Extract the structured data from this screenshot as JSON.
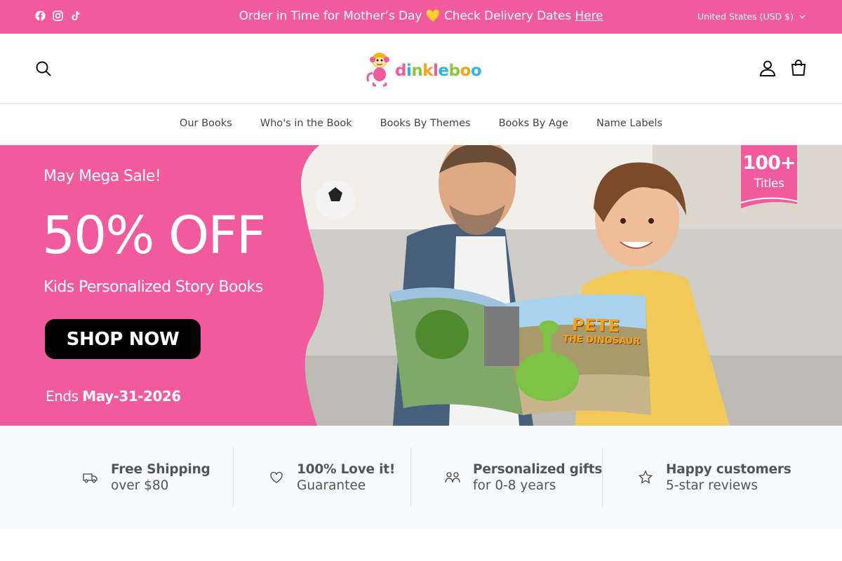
{
  "announcement": {
    "text_before": "Order in Time for Mother’s Day",
    "heart": "💛",
    "text_mid": "Check Delivery Dates",
    "link": "Here",
    "currency": "United States (USD $)"
  },
  "social_icons": [
    "facebook-icon",
    "instagram-icon",
    "tiktok-icon"
  ],
  "header": {
    "logo_text": "dinkleboo",
    "icons": [
      "search-icon",
      "account-icon",
      "cart-icon"
    ]
  },
  "nav": {
    "items": [
      "Our Books",
      "Who's in the Book",
      "Books By Themes",
      "Books By Age",
      "Name Labels"
    ]
  },
  "hero": {
    "kicker": "May Mega Sale!",
    "headline": "50% OFF",
    "subtitle": "Kids Personalized Story Books",
    "cta": "SHOP NOW",
    "ends_label": "Ends",
    "ends_date": "May-31-2026",
    "ribbon_number": "100+",
    "ribbon_label": "Titles",
    "book_title": "PETE",
    "book_subtitle": "THE DINOSAUR"
  },
  "features": [
    {
      "title": "Free Shipping",
      "sub": "over $80",
      "icon": "truck-icon"
    },
    {
      "title": "100% Love it!",
      "sub": "Guarantee",
      "icon": "heart-icon"
    },
    {
      "title": "Personalized gifts",
      "sub": "for 0-8 years",
      "icon": "kids-icon"
    },
    {
      "title": "Happy customers",
      "sub": "5-star reviews",
      "icon": "star-icon"
    }
  ],
  "colors": {
    "brand_pink": "#f25a9e",
    "cta_black": "#000000",
    "features_bg": "#f8f9fb"
  }
}
